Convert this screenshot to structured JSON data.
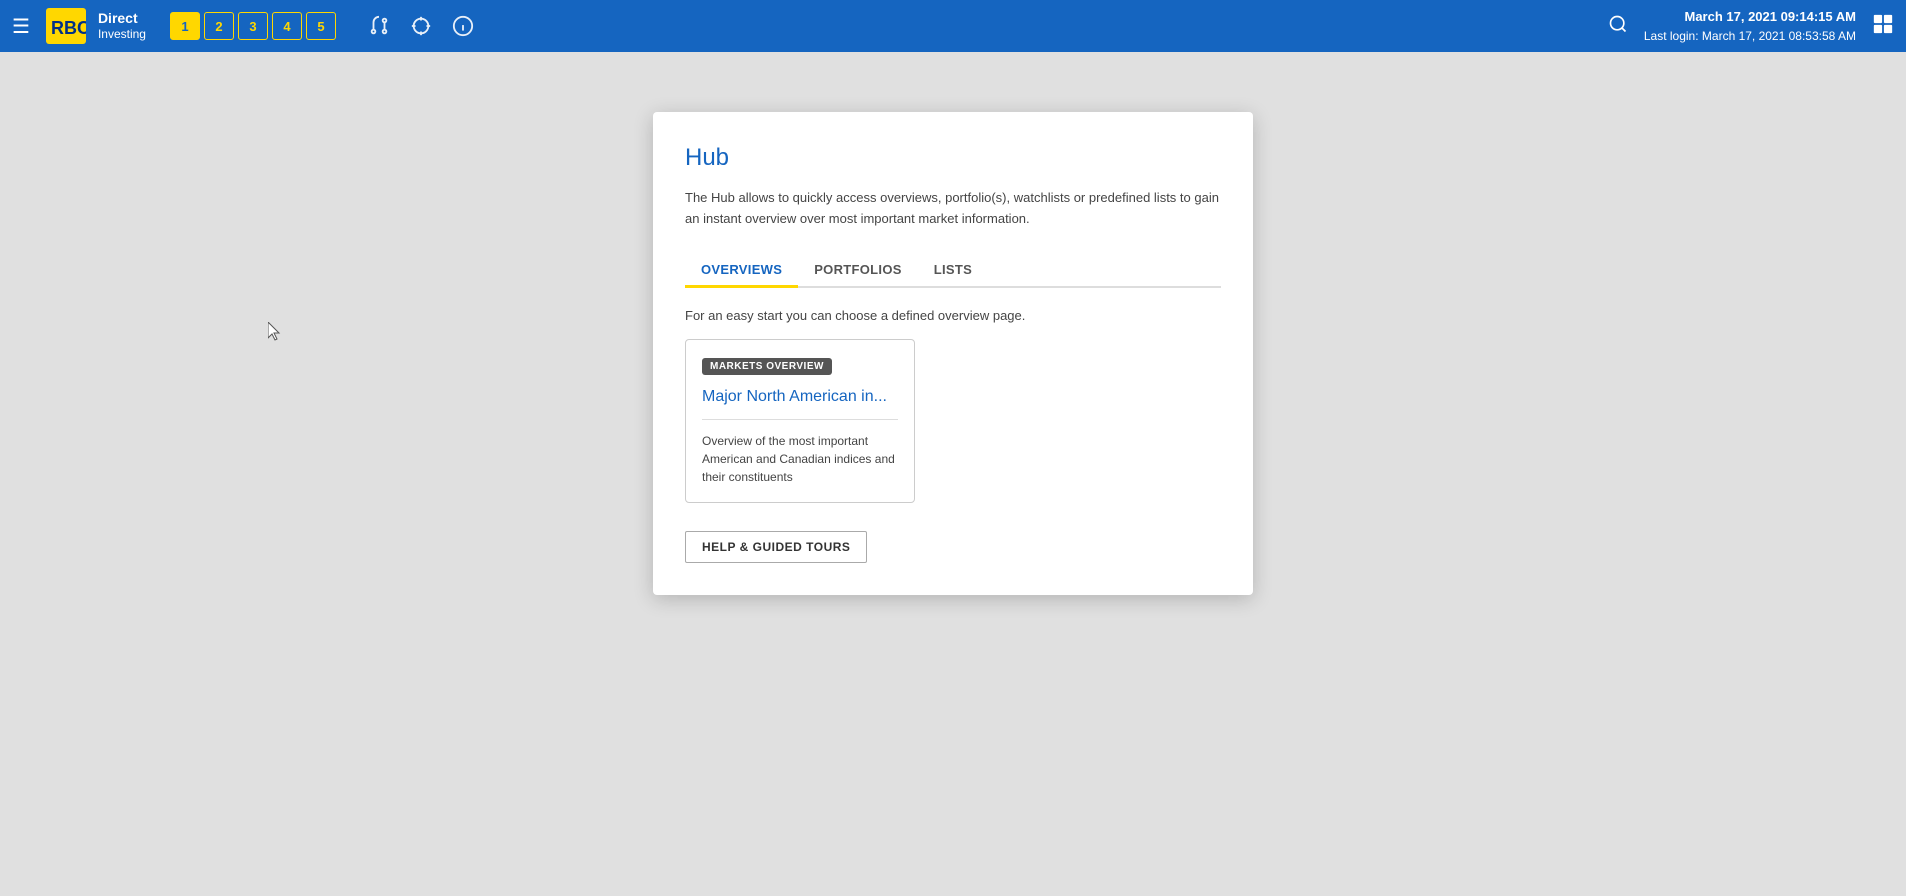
{
  "navbar": {
    "brand": {
      "direct": "Direct",
      "investing": "Investing"
    },
    "tabs": [
      {
        "label": "1",
        "active": true
      },
      {
        "label": "2",
        "active": false
      },
      {
        "label": "3",
        "active": false
      },
      {
        "label": "4",
        "active": false
      },
      {
        "label": "5",
        "active": false
      }
    ],
    "datetime": {
      "main": "March 17, 2021  09:14:15 AM",
      "last_login": "Last login: March 17, 2021 08:53:58 AM"
    }
  },
  "hub": {
    "title": "Hub",
    "description": "The Hub allows to quickly access overviews, portfolio(s), watchlists or predefined lists to gain an instant overview over most important market information.",
    "tabs": [
      {
        "label": "OVERVIEWS",
        "active": true
      },
      {
        "label": "PORTFOLIOS",
        "active": false
      },
      {
        "label": "LISTS",
        "active": false
      }
    ],
    "subtitle": "For an easy start you can choose a defined overview page.",
    "card": {
      "badge": "MARKETS OVERVIEW",
      "title": "Major North American in...",
      "description": "Overview of the most important American and Canadian indices and their constituents"
    },
    "help_button": "HELP & GUIDED TOURS"
  }
}
